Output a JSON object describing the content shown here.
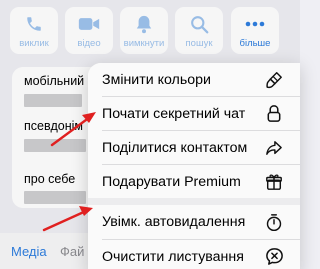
{
  "actions": [
    {
      "id": "call",
      "label": "виклик",
      "icon": "phone-icon"
    },
    {
      "id": "video",
      "label": "відео",
      "icon": "video-camera-icon"
    },
    {
      "id": "mute",
      "label": "вимкнути",
      "icon": "bell-icon"
    },
    {
      "id": "search",
      "label": "пошук",
      "icon": "search-icon"
    },
    {
      "id": "more",
      "label": "більше",
      "icon": "more-dots-icon"
    }
  ],
  "info": {
    "rows": [
      {
        "label": "мобільний"
      },
      {
        "label": "псевдонім"
      },
      {
        "label": "про себе"
      }
    ]
  },
  "tabs": [
    {
      "label": "Медіа",
      "active": true
    },
    {
      "label": "Фай",
      "active": false
    }
  ],
  "menu": {
    "items": [
      {
        "label": "Змінити кольори",
        "icon": "brush-icon"
      },
      {
        "label": "Почати секретний чат",
        "icon": "lock-icon"
      },
      {
        "label": "Поділитися контактом",
        "icon": "share-arrow-icon"
      },
      {
        "label": "Подарувати Premium",
        "icon": "gift-icon"
      },
      {
        "label": "Увімк. автовидалення",
        "icon": "timer-icon"
      },
      {
        "label": "Очистити листування",
        "icon": "clear-chat-icon"
      }
    ]
  },
  "colors": {
    "accent": "#2f7fe0",
    "accent_light": "#9ec3ee",
    "arrow": "#e02020",
    "background": "#efeff4"
  }
}
